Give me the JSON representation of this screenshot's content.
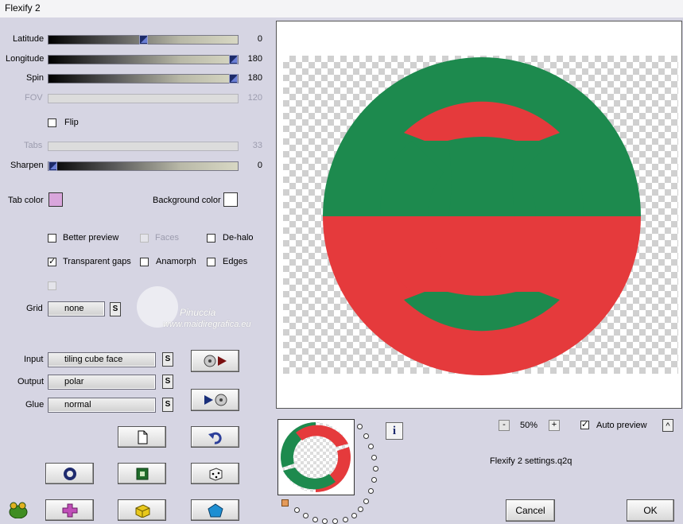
{
  "window": {
    "title": "Flexify 2"
  },
  "sliders": [
    {
      "label": "Latitude",
      "value": "0",
      "fraction": 0.5,
      "enabled": true
    },
    {
      "label": "Longitude",
      "value": "180",
      "fraction": 1.0,
      "enabled": true
    },
    {
      "label": "Spin",
      "value": "180",
      "fraction": 1.0,
      "enabled": true
    },
    {
      "label": "FOV",
      "value": "120",
      "fraction": 0.0,
      "enabled": false
    },
    {
      "label": "Tabs",
      "value": "33",
      "fraction": 0.0,
      "enabled": false
    },
    {
      "label": "Sharpen",
      "value": "0",
      "fraction": 0.0,
      "enabled": true
    }
  ],
  "flip": {
    "label": "Flip",
    "checked": false
  },
  "colors": {
    "tab_label": "Tab color",
    "tab_value": "#d9a6dc",
    "background_label": "Background color",
    "background_value": "#ffffff"
  },
  "options": {
    "better_preview": {
      "label": "Better preview",
      "checked": false
    },
    "faces": {
      "label": "Faces",
      "checked": false
    },
    "de_halo": {
      "label": "De-halo",
      "checked": false
    },
    "transparent_gaps": {
      "label": "Transparent gaps",
      "checked": true
    },
    "anamorph": {
      "label": "Anamorph",
      "checked": false
    },
    "edges": {
      "label": "Edges",
      "checked": false
    }
  },
  "grid": {
    "label": "Grid",
    "value": "none",
    "s_label": "S"
  },
  "io": {
    "input_label": "Input",
    "input_value": "tiling cube face",
    "output_label": "Output",
    "output_value": "polar",
    "glue_label": "Glue",
    "glue_value": "normal",
    "s_label": "S"
  },
  "watermark": {
    "line1": "Pinuccia",
    "line2": "www.maidiregrafica.eu"
  },
  "zoom": {
    "minus": "-",
    "value": "50%",
    "plus": "+"
  },
  "auto_preview": {
    "label": "Auto preview",
    "checked": true,
    "toggle": "^"
  },
  "settings_file": "Flexify 2 settings.q2q",
  "info_icon_text": "i",
  "buttons": {
    "cancel": "Cancel",
    "ok": "OK"
  },
  "preview_colors": {
    "green": "#1d8a4e",
    "red": "#e53a3c"
  }
}
